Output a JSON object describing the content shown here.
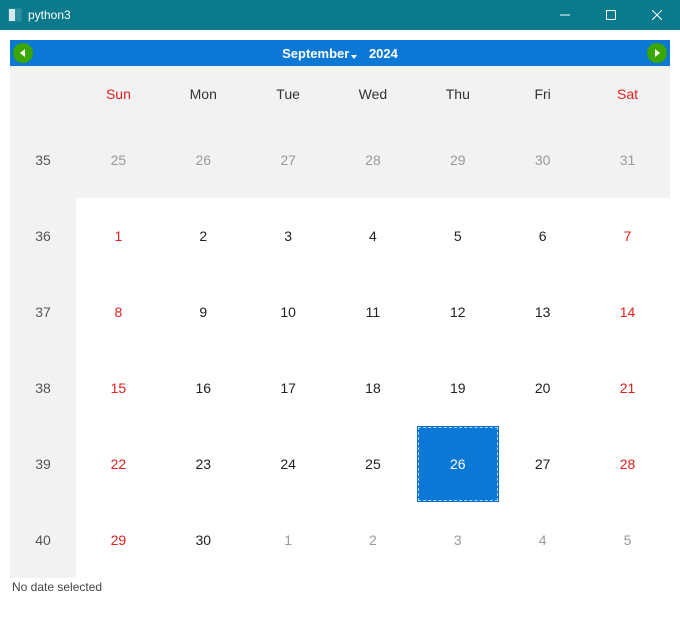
{
  "window": {
    "title": "python3"
  },
  "calendar": {
    "month_label": "September",
    "year_label": "2024",
    "day_headers": [
      "Sun",
      "Mon",
      "Tue",
      "Wed",
      "Thu",
      "Fri",
      "Sat"
    ],
    "weekend_header_indices": [
      0,
      6
    ],
    "week_numbers": [
      35,
      36,
      37,
      38,
      39,
      40
    ],
    "days": [
      [
        {
          "n": 25,
          "outside": true
        },
        {
          "n": 26,
          "outside": true
        },
        {
          "n": 27,
          "outside": true
        },
        {
          "n": 28,
          "outside": true
        },
        {
          "n": 29,
          "outside": true
        },
        {
          "n": 30,
          "outside": true
        },
        {
          "n": 31,
          "outside": true
        }
      ],
      [
        {
          "n": 1,
          "weekend": true
        },
        {
          "n": 2
        },
        {
          "n": 3
        },
        {
          "n": 4
        },
        {
          "n": 5
        },
        {
          "n": 6
        },
        {
          "n": 7,
          "weekend": true
        }
      ],
      [
        {
          "n": 8,
          "weekend": true
        },
        {
          "n": 9
        },
        {
          "n": 10
        },
        {
          "n": 11
        },
        {
          "n": 12
        },
        {
          "n": 13
        },
        {
          "n": 14,
          "weekend": true
        }
      ],
      [
        {
          "n": 15,
          "weekend": true
        },
        {
          "n": 16
        },
        {
          "n": 17
        },
        {
          "n": 18
        },
        {
          "n": 19
        },
        {
          "n": 20
        },
        {
          "n": 21,
          "weekend": true
        }
      ],
      [
        {
          "n": 22,
          "weekend": true
        },
        {
          "n": 23
        },
        {
          "n": 24
        },
        {
          "n": 25
        },
        {
          "n": 26,
          "selected": true
        },
        {
          "n": 27
        },
        {
          "n": 28,
          "weekend": true
        }
      ],
      [
        {
          "n": 29,
          "weekend": true
        },
        {
          "n": 30
        },
        {
          "n": 1,
          "outside": true
        },
        {
          "n": 2,
          "outside": true
        },
        {
          "n": 3,
          "outside": true
        },
        {
          "n": 4,
          "outside": true
        },
        {
          "n": 5,
          "outside": true
        }
      ]
    ]
  },
  "status_text": "No date selected"
}
